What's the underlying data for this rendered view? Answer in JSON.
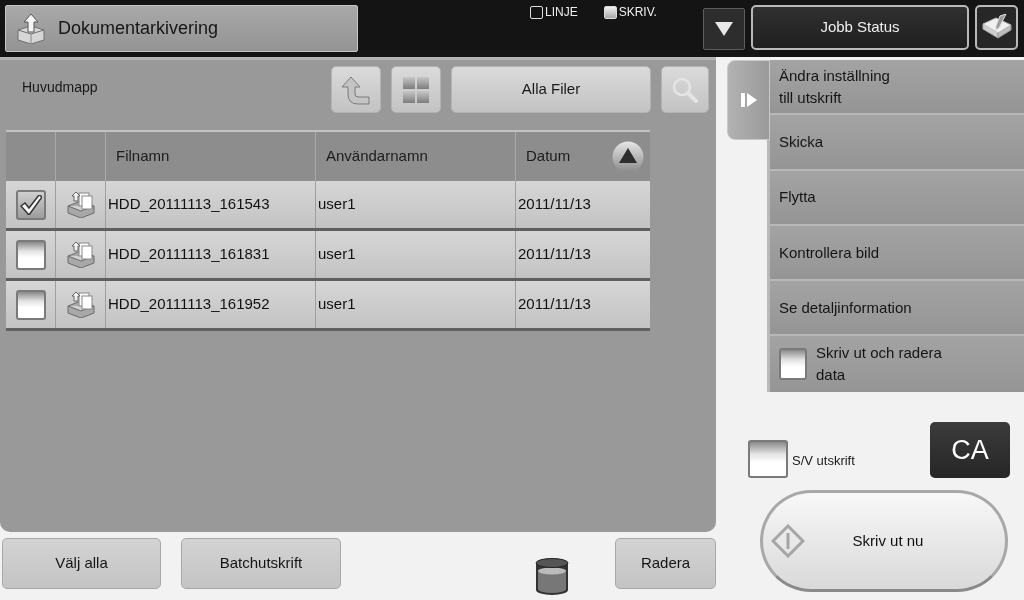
{
  "header": {
    "title": "Dokumentarkivering",
    "indicators": [
      {
        "label": "LINJE",
        "on": false
      },
      {
        "label": "SKRIV.",
        "on": true
      }
    ],
    "job_status_button": "Jobb Status"
  },
  "folder": {
    "name": "Huvudmapp",
    "filter_button": "Alla Filer"
  },
  "table": {
    "columns": [
      {
        "label": "Filnamn",
        "sorted": false
      },
      {
        "label": "Användarnamn",
        "sorted": false
      },
      {
        "label": "Datum",
        "sorted": true
      }
    ],
    "rows": [
      {
        "checked": true,
        "filename": "HDD_20111113_161543",
        "user": "user1",
        "date": "2011/11/13"
      },
      {
        "checked": false,
        "filename": "HDD_20111113_161831",
        "user": "user1",
        "date": "2011/11/13"
      },
      {
        "checked": false,
        "filename": "HDD_20111113_161952",
        "user": "user1",
        "date": "2011/11/13"
      }
    ]
  },
  "actions": [
    {
      "kind": "button",
      "label": "Ändra inställning\ntill utskrift"
    },
    {
      "kind": "button",
      "label": "Skicka"
    },
    {
      "kind": "button",
      "label": "Flytta"
    },
    {
      "kind": "button",
      "label": "Kontrollera bild"
    },
    {
      "kind": "button",
      "label": "Se detaljinformation"
    },
    {
      "kind": "checkbox",
      "label": "Skriv ut och radera\ndata",
      "checked": false
    }
  ],
  "bw_print": {
    "label": "S/V utskrift",
    "checked": false
  },
  "clear_all_button": "CA",
  "print_now_button": "Skriv ut nu",
  "footer": {
    "select_all_button": "Välj alla",
    "batch_print_button": "Batchutskrift",
    "delete_button": "Radera"
  }
}
